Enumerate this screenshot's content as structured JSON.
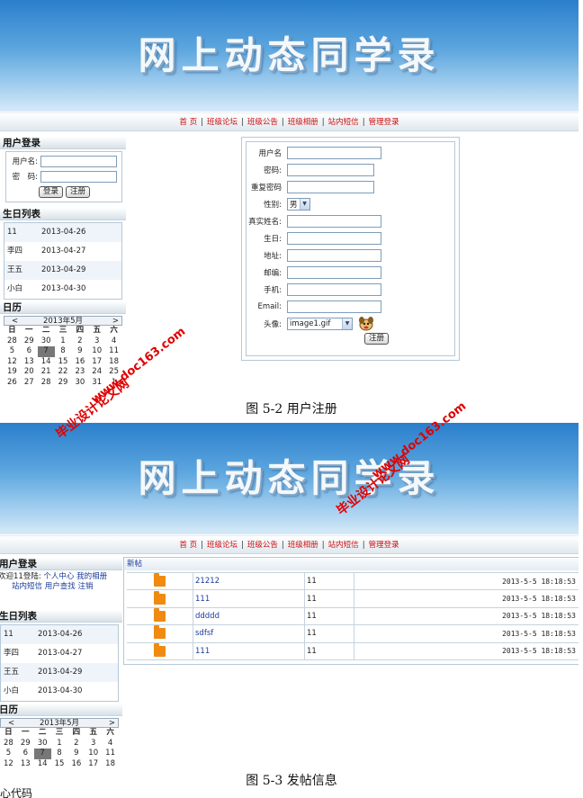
{
  "shot1": {
    "banner_title": "网上动态同学录",
    "nav": [
      "首 页",
      "班级论坛",
      "班级公告",
      "班级相册",
      "站内短信",
      "管理登录"
    ],
    "nav_sep": "|",
    "login": {
      "title": "用户登录",
      "user_label": "用户名:",
      "pwd_label": "密　码:",
      "login_btn": "登录",
      "register_btn": "注册"
    },
    "birthday": {
      "title": "生日列表",
      "rows": [
        {
          "name": "11",
          "date": "2013-04-26"
        },
        {
          "name": "李四",
          "date": "2013-04-27"
        },
        {
          "name": "王五",
          "date": "2013-04-29"
        },
        {
          "name": "小白",
          "date": "2013-04-30"
        }
      ]
    },
    "calendar": {
      "title": "日历",
      "month": "2013年5月",
      "prev": "<",
      "next": ">",
      "weekdays": [
        "日",
        "一",
        "二",
        "三",
        "四",
        "五",
        "六"
      ],
      "days": [
        "28",
        "29",
        "30",
        "1",
        "2",
        "3",
        "4",
        "5",
        "6",
        "7",
        "8",
        "9",
        "10",
        "11",
        "12",
        "13",
        "14",
        "15",
        "16",
        "17",
        "18",
        "19",
        "20",
        "21",
        "22",
        "23",
        "24",
        "25",
        "26",
        "27",
        "28",
        "29",
        "30",
        "31",
        "1"
      ],
      "today": "7"
    },
    "register": {
      "fields": [
        "用户名",
        "密码:",
        "重复密码",
        "性别:",
        "真实姓名:",
        "生日:",
        "地址:",
        "邮编:",
        "手机:",
        "Email:",
        "头像:"
      ],
      "gender_value": "男",
      "avatar_value": "image1.gif",
      "submit": "注册"
    }
  },
  "caption1": "图 5-2 用户注册",
  "watermark": {
    "line1": "毕业设计论文网",
    "line2": "www.doc163.com"
  },
  "shot2": {
    "welcome": {
      "text": "欢迎11登陆:",
      "links": [
        "个人中心",
        "我的相册",
        "站内短信",
        "用户查找",
        "注销"
      ]
    },
    "birthday": {
      "title": "生日列表",
      "rows": [
        {
          "name": "11",
          "date": "2013-04-26"
        },
        {
          "name": "李四",
          "date": "2013-04-27"
        },
        {
          "name": "王五",
          "date": "2013-04-29"
        },
        {
          "name": "小白",
          "date": "2013-04-30"
        }
      ]
    },
    "calendar": {
      "title": "日历",
      "month": "2013年5月",
      "weekdays": [
        "日",
        "一",
        "二",
        "三",
        "四",
        "五",
        "六"
      ],
      "days": [
        "28",
        "29",
        "30",
        "1",
        "2",
        "3",
        "4",
        "5",
        "6",
        "7",
        "8",
        "9",
        "10",
        "11",
        "12",
        "13",
        "14",
        "15",
        "16",
        "17",
        "18"
      ],
      "today": "7"
    },
    "forum": {
      "title": "新帖",
      "rows": [
        {
          "subject": "21212",
          "author": "11",
          "time": "2013-5-5 18:18:53"
        },
        {
          "subject": "111",
          "author": "11",
          "time": "2013-5-5 18:18:53"
        },
        {
          "subject": "ddddd",
          "author": "11",
          "time": "2013-5-5 18:18:53"
        },
        {
          "subject": "sdfsf",
          "author": "11",
          "time": "2013-5-5 18:18:53"
        },
        {
          "subject": "111",
          "author": "11",
          "time": "2013-5-5 18:18:53"
        }
      ]
    }
  },
  "caption2": "图 5-3 发帖信息",
  "tail_text": "心代码"
}
